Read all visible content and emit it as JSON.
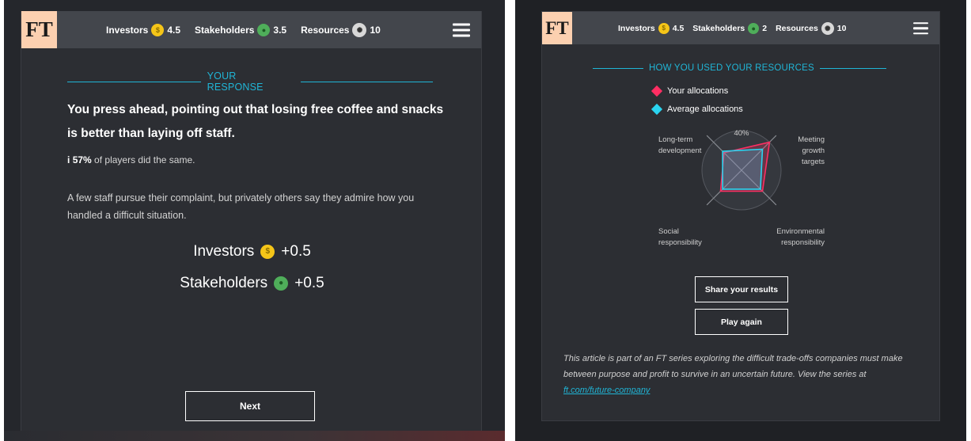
{
  "left": {
    "logo": "FT",
    "scores": [
      {
        "label": "Investors",
        "icon": "coin-icon",
        "value": "4.5"
      },
      {
        "label": "Stakeholders",
        "icon": "globe-icon",
        "value": "3.5"
      },
      {
        "label": "Resources",
        "icon": "brain-icon",
        "value": "10"
      }
    ],
    "section_title": "YOUR RESPONSE",
    "headline": "You press ahead, pointing out that losing free coffee and snacks is better than laying off staff.",
    "stat_percent": "57%",
    "stat_text": " of players did the same.",
    "stat_icon": "i",
    "body": "A few staff pursue their complaint, but privately others say they admire how you handled a difficult situation.",
    "deltas": [
      {
        "label": "Investors",
        "icon": "coin-icon",
        "value": "+0.5"
      },
      {
        "label": "Stakeholders",
        "icon": "globe-icon",
        "value": "+0.5"
      }
    ],
    "next_label": "Next"
  },
  "right": {
    "logo": "FT",
    "scores": [
      {
        "label": "Investors",
        "icon": "coin-icon",
        "value": "4.5"
      },
      {
        "label": "Stakeholders",
        "icon": "globe-icon",
        "value": "2"
      },
      {
        "label": "Resources",
        "icon": "brain-icon",
        "value": "10"
      }
    ],
    "section_title": "HOW YOU USED YOUR RESOURCES",
    "legend": [
      {
        "label": "Your allocations",
        "color": "#ff2e63"
      },
      {
        "label": "Average allocations",
        "color": "#2ad4f0"
      }
    ],
    "radar_ring_label": "40%",
    "axes": {
      "top_left": "Long-term development",
      "top_right": "Meeting growth targets",
      "bottom_left": "Social responsibility",
      "bottom_right": "Environmental responsibility"
    },
    "share_label": "Share your results",
    "play_again_label": "Play again",
    "footnote_text": "This article is part of an FT series exploring the difficult trade-offs companies must make between purpose and profit to survive in an uncertain future. View the series at ",
    "footnote_link": "ft.com/future-company"
  },
  "chart_data": {
    "type": "radar",
    "axes": [
      "Long-term development",
      "Meeting growth targets",
      "Environmental responsibility",
      "Social responsibility"
    ],
    "max": 40,
    "series": [
      {
        "name": "Your allocations",
        "values": [
          25,
          40,
          30,
          30
        ]
      },
      {
        "name": "Average allocations",
        "values": [
          27,
          30,
          27,
          27
        ]
      }
    ]
  }
}
